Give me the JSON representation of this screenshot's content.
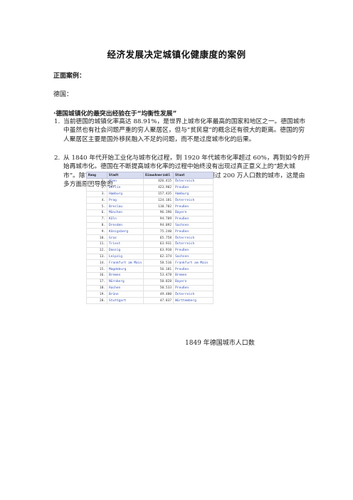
{
  "title": "经济发展决定城镇化健康度的案例",
  "positive_heading": "正面案例：",
  "country": "德国：",
  "bullet": "·德国城镇化的最突出经验在于“均衡性发展”",
  "paragraphs": [
    {
      "num": "1.",
      "text": "当前德国的城镇化率高达 88.91%，是世界上城市化率最高的国家和地区之一。德国城市中虽然也有社会问题严重的穷人聚居区，但与“贫民窟”的概念还有很大的距离。德国的穷人聚居区主要是国外移民融入不足的问题，而不是过度城市化的后果。"
    },
    {
      "num": "2.",
      "text": "从 1840 年代开始工业化与城市化过程，到 1920 年代城市化率超过 60%，再到如今的开始再城市化。德国在不断提高城市化率的过程中始终没有出现过真正意义上的“超大城市”。除首都柏林外，在整个德国历史上再没有第二个超过 200 万人口数的城市，这是由多方面原因导致的。"
    }
  ],
  "table": {
    "headers": [
      "Rang",
      "Stadt",
      "Einwohnerzahl",
      "Staat"
    ],
    "rows": [
      [
        "1.",
        "Wien",
        "426.415",
        "Österreich"
      ],
      [
        "2.",
        "Berlin",
        "423.902",
        "Preußen"
      ],
      [
        "3.",
        "Hamburg",
        "157.435",
        "Hamburg"
      ],
      [
        "4.",
        "Prag",
        "124.181",
        "Österreich"
      ],
      [
        "5.",
        "Breslau",
        "110.702",
        "Preußen"
      ],
      [
        "6.",
        "München",
        "96.396",
        "Bayern"
      ],
      [
        "7.",
        "Köln",
        "94.789",
        "Preußen"
      ],
      [
        "8.",
        "Dresden",
        "94.092",
        "Sachsen"
      ],
      [
        "9.",
        "Königsberg",
        "75.240",
        "Preußen"
      ],
      [
        "10.",
        "Graz",
        "65.758",
        "Österreich"
      ],
      [
        "11.",
        "Triest",
        "63.931",
        "Österreich"
      ],
      [
        "12.",
        "Danzig",
        "63.910",
        "Preußen"
      ],
      [
        "13.",
        "Leipzig",
        "62.374",
        "Sachsen"
      ],
      [
        "14.",
        "Frankfurt am Main",
        "58.516",
        "Frankfurt am Main"
      ],
      [
        "15.",
        "Magdeburg",
        "56.181",
        "Preußen"
      ],
      [
        "16.",
        "Bremen",
        "53.478",
        "Bremen"
      ],
      [
        "17.",
        "Nürnberg",
        "50.828",
        "Bayern"
      ],
      [
        "18.",
        "Aachen",
        "50.533",
        "Preußen"
      ],
      [
        "19.",
        "Brünn",
        "49.480",
        "Österreich"
      ],
      [
        "20.",
        "Stuttgart",
        "47.837",
        "Württemberg"
      ]
    ]
  },
  "caption": "1849 年德国城市人口数",
  "colors": {
    "header_bg": "#d8dcf0",
    "link": "#2f4fbf"
  }
}
